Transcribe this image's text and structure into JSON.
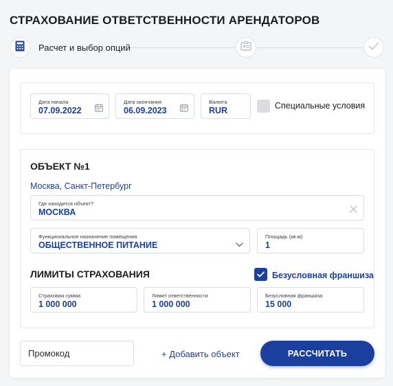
{
  "page": {
    "title": "СТРАХОВАНИЕ ОТВЕТСТВЕННОСТИ АРЕНДАТОРОВ"
  },
  "stepper": {
    "step1_label": "Расчет и выбор опций",
    "icons": [
      "calculator-icon",
      "id-card-icon",
      "check-icon"
    ]
  },
  "period": {
    "start": {
      "label": "Дата начала",
      "value": "07.09.2022"
    },
    "end": {
      "label": "Дата окончания",
      "value": "06.09.2023"
    },
    "currency": {
      "label": "Валюта",
      "value": "RUR"
    },
    "special_conditions": {
      "label": "Специальные условия",
      "checked": false
    }
  },
  "object": {
    "title": "ОБЪЕКТ №1",
    "city_link": "Москва, Санкт-Петербург",
    "location": {
      "label": "Где находится объект?",
      "value": "МОСКВА"
    },
    "purpose": {
      "label": "Функциональное назначение помещения",
      "value": "ОБЩЕСТВЕННОЕ ПИТАНИЕ"
    },
    "area": {
      "label": "Площадь (кв.м)",
      "value": "1"
    }
  },
  "limits": {
    "title": "ЛИМИТЫ СТРАХОВАНИЯ",
    "unconditional_franchise": {
      "label": "Безусловная франшиза",
      "checked": true
    },
    "sum_insured": {
      "label": "Страховая сумма",
      "value": "1 000 000"
    },
    "liability_limit": {
      "label": "Лимит ответственности",
      "value": "1 000 000"
    },
    "franchise": {
      "label": "Безусловная франшиза",
      "value": "15 000"
    }
  },
  "footer": {
    "promo_placeholder": "Промокод",
    "add_object": "+ Добавить объект",
    "calculate": "РАССЧИТАТЬ"
  },
  "colors": {
    "accent": "#1a3f9e",
    "background": "#f4f5f7",
    "checkbox_off": "#dcdde1"
  }
}
